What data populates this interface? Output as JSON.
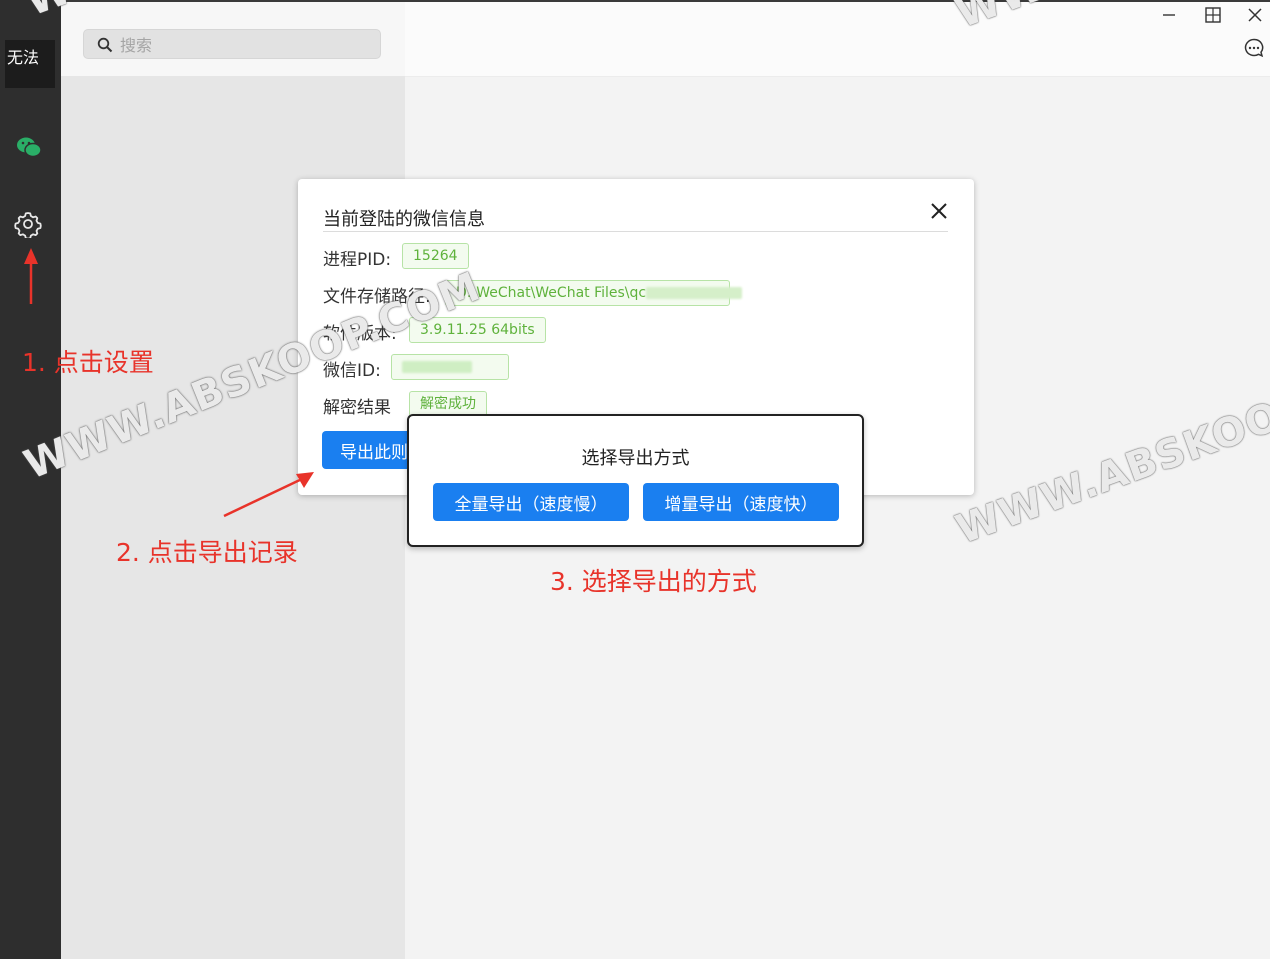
{
  "sidebar": {
    "avatar_alt": "无法"
  },
  "search": {
    "placeholder": "搜索"
  },
  "info_dialog": {
    "title": "当前登陆的微信信息",
    "rows": [
      {
        "label": "进程PID:",
        "value": "15264"
      },
      {
        "label": "文件存储路径:",
        "value": "D:\\WeChat\\WeChat Files\\qc"
      },
      {
        "label": "软件版本:",
        "value": "3.9.11.25 64bits"
      },
      {
        "label": "微信ID:",
        "value": ""
      },
      {
        "label": "解密结果",
        "value": "解密成功"
      }
    ],
    "export_button": "导出此则"
  },
  "export_dialog": {
    "title": "选择导出方式",
    "full_button": "全量导出（速度慢）",
    "incremental_button": "增量导出（速度快）"
  },
  "annotations": {
    "step1": "1. 点击设置",
    "step2": "2. 点击导出记录",
    "step3": "3. 选择导出的方式"
  },
  "watermarks": [
    "WWW.ABSKOOP.COM",
    "WWW.ABSKOOP.",
    "WW",
    "WWW"
  ],
  "colors": {
    "accent": "#1a7ff0",
    "annotation": "#e8332a",
    "tag_green": "#5fb23c",
    "nav_bg": "#2e2e2e"
  }
}
